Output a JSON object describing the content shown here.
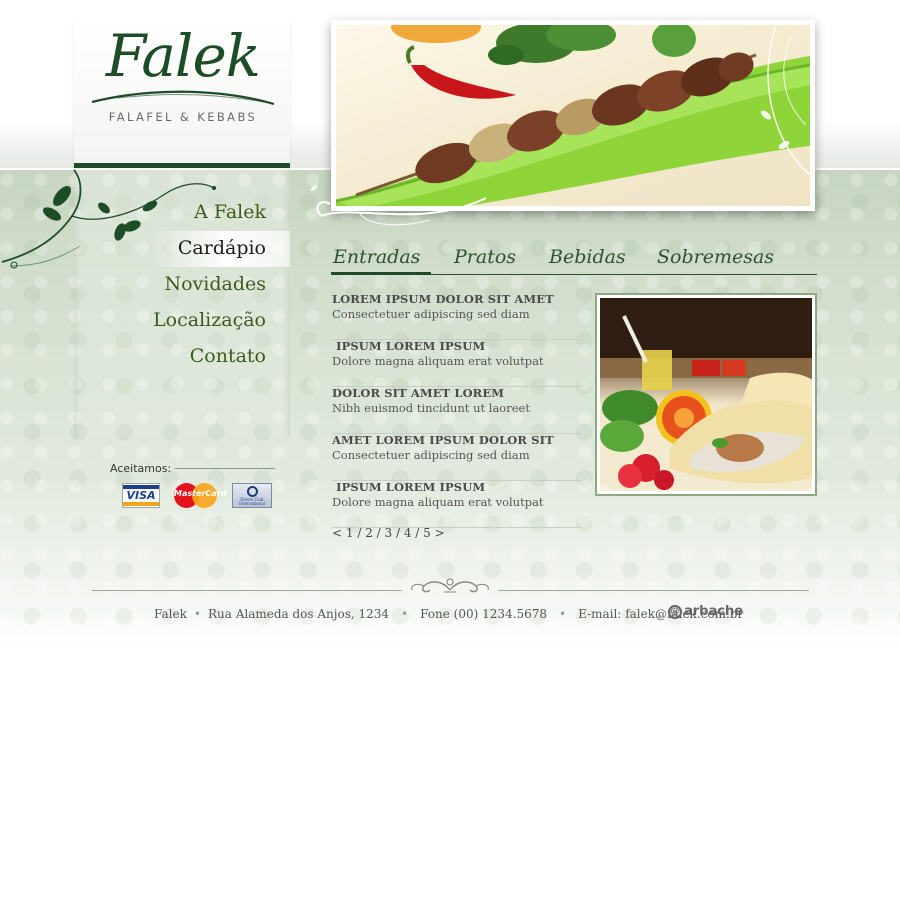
{
  "brand": {
    "name": "Falek",
    "tagline": "FALAFEL & KEBABS"
  },
  "nav": {
    "items": [
      {
        "label": "A Falek",
        "active": false
      },
      {
        "label": "Cardápio",
        "active": true
      },
      {
        "label": "Novidades",
        "active": false
      },
      {
        "label": "Localização",
        "active": false
      },
      {
        "label": "Contato",
        "active": false
      }
    ]
  },
  "payments": {
    "label": "Aceitamos:",
    "cards": [
      {
        "name": "VISA",
        "icon": "visa-card-icon"
      },
      {
        "name": "MasterCard",
        "icon": "mastercard-card-icon"
      },
      {
        "name": "Diners Club International",
        "icon": "diners-card-icon"
      }
    ]
  },
  "tabs": [
    {
      "label": "Entradas",
      "active": true
    },
    {
      "label": "Pratos",
      "active": false
    },
    {
      "label": "Bebidas",
      "active": false
    },
    {
      "label": "Sobremesas",
      "active": false
    }
  ],
  "menu": {
    "items": [
      {
        "title": "LOREM IPSUM DOLOR SIT AMET",
        "desc": "Consectetuer adipiscing sed diam"
      },
      {
        "title": " IPSUM LOREM IPSUM",
        "desc": "Dolore magna aliquam erat volutpat"
      },
      {
        "title": "DOLOR SIT AMET LOREM",
        "desc": "Nibh euismod tincidunt ut laoreet"
      },
      {
        "title": "AMET LOREM IPSUM DOLOR SIT",
        "desc": "Consectetuer adipiscing sed diam"
      },
      {
        "title": " IPSUM LOREM IPSUM",
        "desc": "Dolore magna aliquam erat volutpat"
      }
    ],
    "pager": {
      "prev": "<",
      "pages": [
        "1",
        "2",
        "3",
        "4",
        "5"
      ],
      "separator": " / ",
      "next": ">"
    }
  },
  "footer": {
    "name": "Falek",
    "address": "Rua Alameda dos Anjos, 1234",
    "phone": "Fone (00) 1234.5678",
    "email": "E-mail: falek@falek.com.br",
    "credit": "arbache"
  },
  "colors": {
    "brand_green": "#1f4d2a",
    "nav_text": "#3d5a1c",
    "tab_text": "#2e5230",
    "band_bg": "#c7d6c0"
  }
}
